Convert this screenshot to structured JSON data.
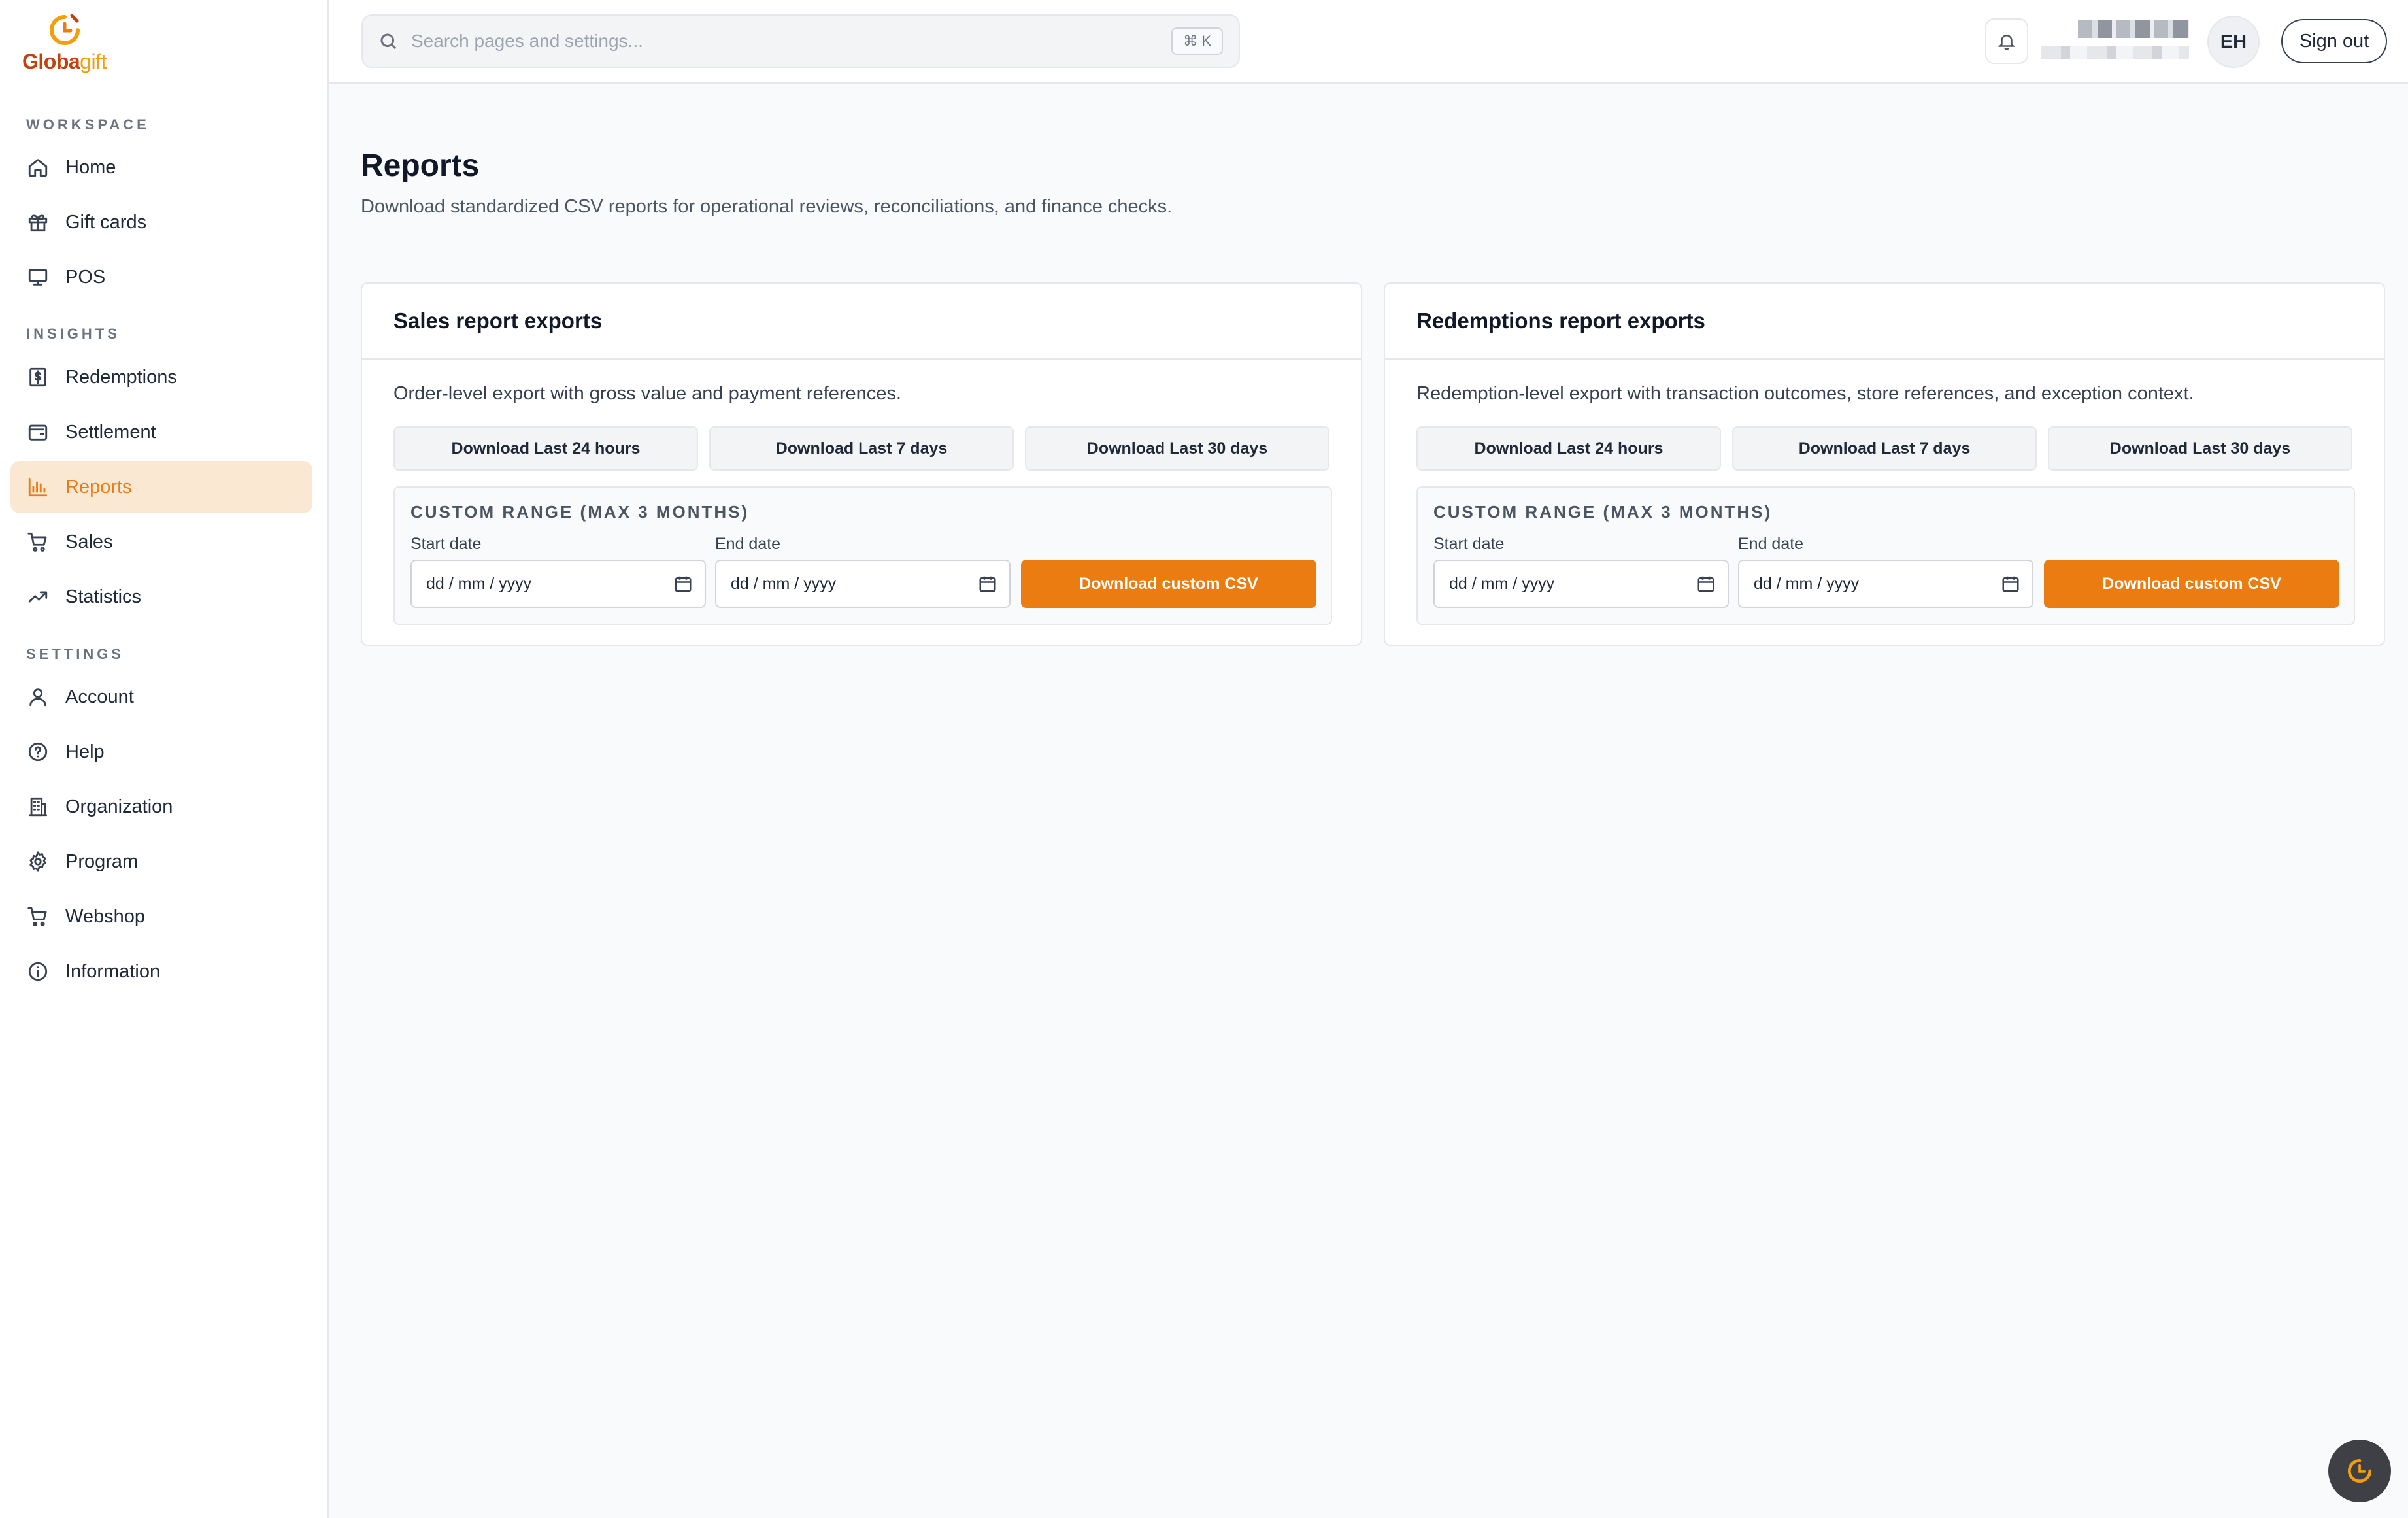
{
  "brand": {
    "name_part1": "Globa",
    "name_part2": "gift",
    "accent": "#ea7c12"
  },
  "sidebar": {
    "sections": {
      "workspace": "WORKSPACE",
      "insights": "INSIGHTS",
      "settings": "SETTINGS"
    },
    "items": [
      {
        "label": "Home",
        "icon": "home-icon"
      },
      {
        "label": "Gift cards",
        "icon": "gift-icon"
      },
      {
        "label": "POS",
        "icon": "monitor-icon"
      },
      {
        "label": "Redemptions",
        "icon": "dollar-receipt-icon"
      },
      {
        "label": "Settlement",
        "icon": "wallet-icon"
      },
      {
        "label": "Reports",
        "icon": "bar-chart-icon",
        "active": true
      },
      {
        "label": "Sales",
        "icon": "cart-icon"
      },
      {
        "label": "Statistics",
        "icon": "trend-icon"
      },
      {
        "label": "Account",
        "icon": "user-icon"
      },
      {
        "label": "Help",
        "icon": "help-circle-icon"
      },
      {
        "label": "Organization",
        "icon": "building-icon"
      },
      {
        "label": "Program",
        "icon": "gear-icon"
      },
      {
        "label": "Webshop",
        "icon": "cart-icon"
      },
      {
        "label": "Information",
        "icon": "info-icon"
      }
    ]
  },
  "topbar": {
    "search_placeholder": "Search pages and settings...",
    "shortcut": "⌘ K",
    "avatar_initials": "EH",
    "sign_out": "Sign out"
  },
  "page": {
    "title": "Reports",
    "subtitle": "Download standardized CSV reports for operational reviews, reconciliations, and finance checks."
  },
  "cards": [
    {
      "title": "Sales report exports",
      "description": "Order-level export with gross value and payment references.",
      "quick_buttons": [
        "Download Last 24 hours",
        "Download Last 7 days",
        "Download Last 30 days"
      ],
      "custom_title": "CUSTOM RANGE (MAX 3 MONTHS)",
      "start_label": "Start date",
      "end_label": "End date",
      "date_placeholder": "dd / mm / yyyy",
      "custom_button": "Download custom CSV"
    },
    {
      "title": "Redemptions report exports",
      "description": "Redemption-level export with transaction outcomes, store references, and exception context.",
      "quick_buttons": [
        "Download Last 24 hours",
        "Download Last 7 days",
        "Download Last 30 days"
      ],
      "custom_title": "CUSTOM RANGE (MAX 3 MONTHS)",
      "start_label": "Start date",
      "end_label": "End date",
      "date_placeholder": "dd / mm / yyyy",
      "custom_button": "Download custom CSV"
    }
  ]
}
